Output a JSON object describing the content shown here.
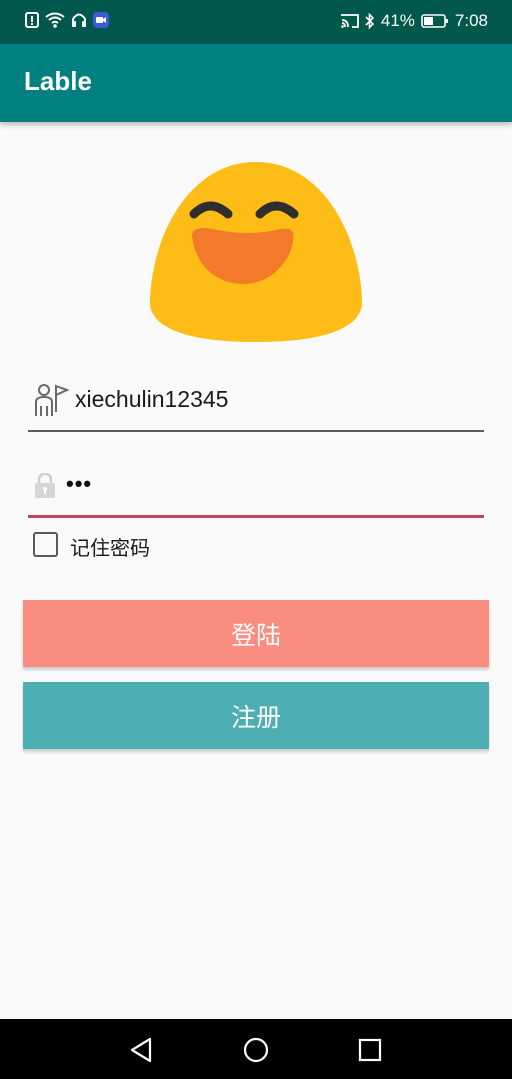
{
  "status_bar": {
    "battery_percent": "41%",
    "time": "7:08",
    "icons": [
      "alert-icon",
      "wifi-icon",
      "headphones-icon",
      "video-app-icon",
      "cast-icon",
      "bluetooth-icon",
      "battery-icon"
    ]
  },
  "app_bar": {
    "title": "Lable"
  },
  "login_form": {
    "username": {
      "value": "xiechulin12345",
      "icon": "user-flag-icon"
    },
    "password": {
      "value": "•••",
      "icon": "lock-icon"
    },
    "remember": {
      "label": "记住密码",
      "checked": false
    }
  },
  "buttons": {
    "login_label": "登陆",
    "register_label": "注册"
  },
  "colors": {
    "status_bar": "#00574b",
    "app_bar": "#008080",
    "login_button": "#fa8c80",
    "register_button": "#4dafb4",
    "password_underline": "#c2435f",
    "username_underline": "#5d5d5d",
    "background": "#fafafa"
  },
  "nav_bar": {
    "icons": [
      "back-icon",
      "home-icon",
      "recents-icon"
    ]
  }
}
